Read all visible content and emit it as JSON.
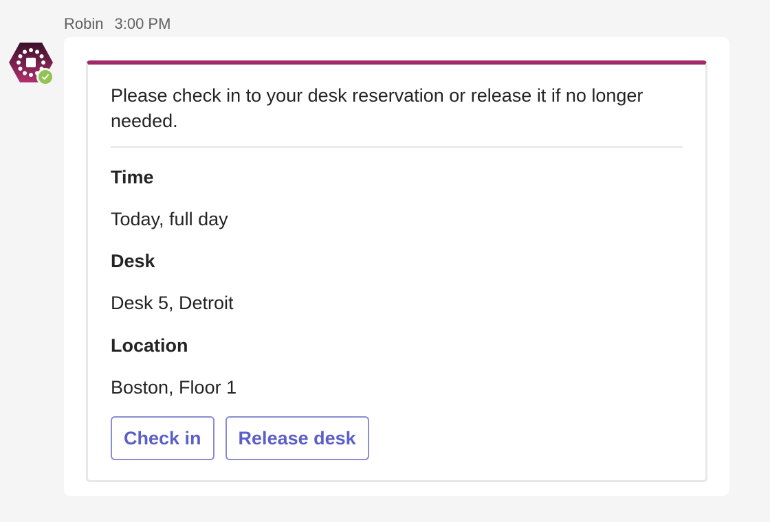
{
  "message": {
    "sender": "Robin",
    "time": "3:00 PM"
  },
  "avatar": {
    "icon": "robin-logo-icon",
    "presence": "available",
    "brand_color": "#a02a68",
    "presence_color": "#92c353"
  },
  "card": {
    "accent_color": "#a02a68",
    "intro": "Please check in to your desk reservation or release it if no longer needed.",
    "fields": [
      {
        "label": "Time",
        "value": "Today, full day"
      },
      {
        "label": "Desk",
        "value": "Desk 5, Detroit"
      },
      {
        "label": "Location",
        "value": "Boston, Floor 1"
      }
    ],
    "actions": {
      "check_in": "Check in",
      "release": "Release desk"
    }
  }
}
